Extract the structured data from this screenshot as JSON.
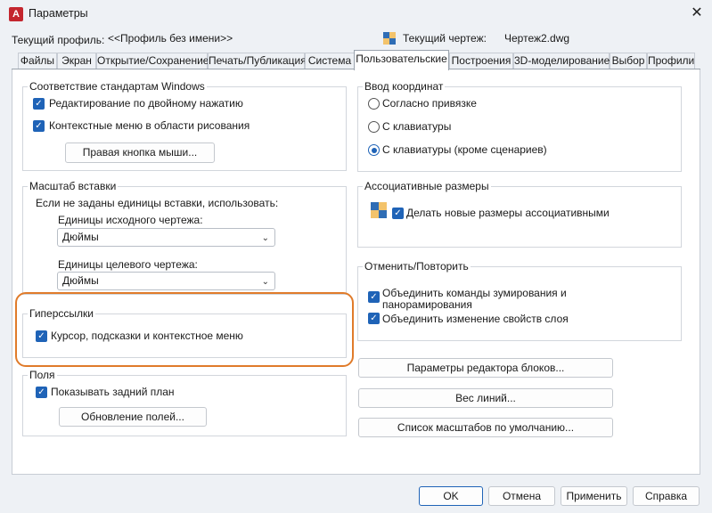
{
  "window": {
    "title": "Параметры",
    "app_icon_letter": "A",
    "close_glyph": "✕"
  },
  "header": {
    "profile_label": "Текущий профиль:",
    "profile_value": "<<Профиль без имени>>",
    "drawing_label": "Текущий чертеж:",
    "drawing_value": "Чертеж2.dwg"
  },
  "tabs": [
    {
      "label": "Файлы"
    },
    {
      "label": "Экран"
    },
    {
      "label": "Открытие/Сохранение"
    },
    {
      "label": "Печать/Публикация"
    },
    {
      "label": "Система"
    },
    {
      "label": "Пользовательские",
      "active": true
    },
    {
      "label": "Построения"
    },
    {
      "label": "3D-моделирование"
    },
    {
      "label": "Выбор"
    },
    {
      "label": "Профили"
    }
  ],
  "windows_standards": {
    "title": "Соответствие стандартам Windows",
    "items": [
      {
        "label": "Редактирование по двойному нажатию",
        "checked": true
      },
      {
        "label": "Контекстные меню в области рисования",
        "checked": true
      }
    ],
    "right_click_button": "Правая кнопка мыши..."
  },
  "insertion_scale": {
    "title": "Масштаб вставки",
    "note": "Если не заданы единицы вставки, использовать:",
    "source_label": "Единицы исходного чертежа:",
    "source_value": "Дюймы",
    "target_label": "Единицы целевого чертежа:",
    "target_value": "Дюймы"
  },
  "hyperlinks": {
    "title": "Гиперссылки",
    "item": {
      "label": "Курсор, подсказки и контекстное меню",
      "checked": true
    }
  },
  "fields": {
    "title": "Поля",
    "item": {
      "label": "Показывать задний план",
      "checked": true
    },
    "update_button": "Обновление полей..."
  },
  "coordinate_input": {
    "title": "Ввод координат",
    "options": [
      {
        "label": "Согласно привязке",
        "selected": false
      },
      {
        "label": "С клавиатуры",
        "selected": false
      },
      {
        "label": "С клавиатуры (кроме сценариев)",
        "selected": true
      }
    ]
  },
  "assoc_dims": {
    "title": "Ассоциативные размеры",
    "item": {
      "label": "Делать новые размеры ассоциативными",
      "checked": true
    }
  },
  "undo_redo": {
    "title": "Отменить/Повторить",
    "item1_line1": "Объединить команды зумирования и",
    "item1_line2": "панорамирования",
    "item2": "Объединить изменение свойств слоя"
  },
  "right_buttons": {
    "block_editor": "Параметры редактора блоков...",
    "lineweight": "Вес линий...",
    "scale_list": "Список масштабов по умолчанию..."
  },
  "footer": {
    "ok": "OK",
    "cancel": "Отмена",
    "apply": "Применить",
    "help": "Справка"
  },
  "colors": {
    "accent": "#1f63b7",
    "highlight": "#e07b2a",
    "app_icon": "#c4262e"
  }
}
